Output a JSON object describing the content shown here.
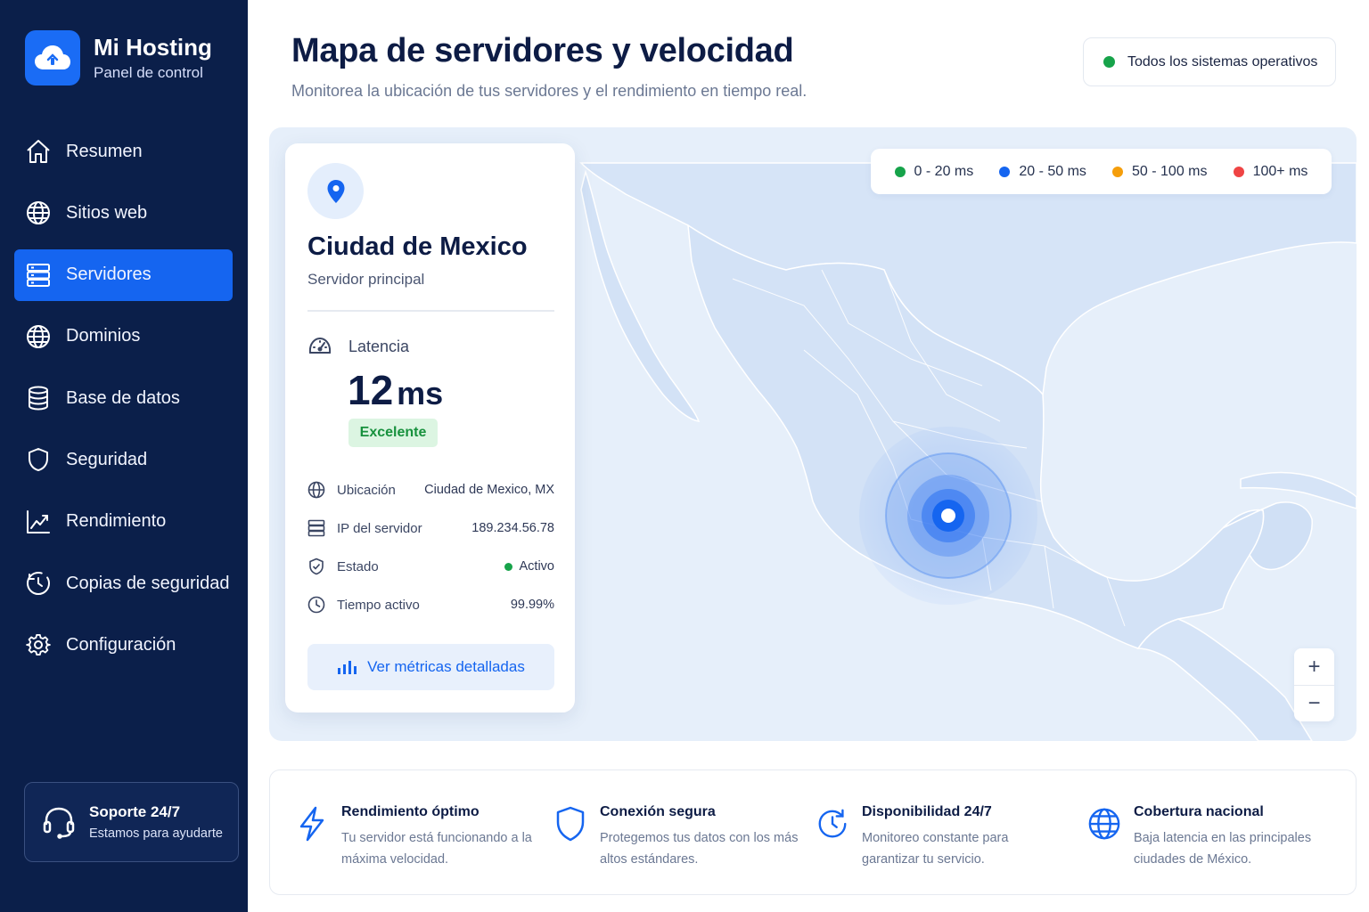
{
  "brand": {
    "title": "Mi Hosting",
    "subtitle": "Panel de control"
  },
  "nav": [
    {
      "label": "Resumen",
      "icon": "home-icon"
    },
    {
      "label": "Sitios web",
      "icon": "globe-icon"
    },
    {
      "label": "Servidores",
      "icon": "server-icon",
      "active": true
    },
    {
      "label": "Dominios",
      "icon": "globe-icon"
    },
    {
      "label": "Base de datos",
      "icon": "database-icon"
    },
    {
      "label": "Seguridad",
      "icon": "shield-icon"
    },
    {
      "label": "Rendimiento",
      "icon": "chart-line-icon"
    },
    {
      "label": "Copias de seguridad",
      "icon": "backup-icon"
    },
    {
      "label": "Configuración",
      "icon": "gear-icon"
    }
  ],
  "support": {
    "title": "Soporte 24/7",
    "subtitle": "Estamos para ayudarte"
  },
  "header": {
    "title": "Mapa de servidores y velocidad",
    "subtitle": "Monitorea la ubicación de tus servidores y el rendimiento en tiempo real.",
    "status": "Todos los sistemas operativos"
  },
  "legend": [
    {
      "label": "0 - 20 ms",
      "color": "#16a34a"
    },
    {
      "label": "20 - 50 ms",
      "color": "#1565f0"
    },
    {
      "label": "50 - 100 ms",
      "color": "#f59e0b"
    },
    {
      "label": "100+ ms",
      "color": "#ef4444"
    }
  ],
  "zoom": {
    "in": "+",
    "out": "−"
  },
  "server": {
    "city": "Ciudad de Mexico",
    "role": "Servidor principal",
    "latency_label": "Latencia",
    "latency_value": "12",
    "latency_unit": "ms",
    "rating": "Excelente",
    "details": [
      {
        "label": "Ubicación",
        "value": "Ciudad de Mexico, MX",
        "icon": "globe-icon"
      },
      {
        "label": "IP del servidor",
        "value": "189.234.56.78",
        "icon": "server-icon"
      },
      {
        "label": "Estado",
        "value": "Activo",
        "icon": "shield-check-icon"
      },
      {
        "label": "Tiempo activo",
        "value": "99.99%",
        "icon": "clock-icon"
      }
    ],
    "metrics_button": "Ver métricas detalladas"
  },
  "features": [
    {
      "title": "Rendimiento óptimo",
      "desc": "Tu servidor está funcionando a la máxima velocidad.",
      "icon": "lightning-icon"
    },
    {
      "title": "Conexión segura",
      "desc": "Protegemos tus datos con los más altos estándares.",
      "icon": "shield-icon"
    },
    {
      "title": "Disponibilidad 24/7",
      "desc": "Monitoreo constante para garantizar tu servicio.",
      "icon": "clock-refresh-icon"
    },
    {
      "title": "Cobertura nacional",
      "desc": "Baja latencia en las principales ciudades de México.",
      "icon": "globe-icon"
    }
  ],
  "colors": {
    "sidebar": "#0b1f4a",
    "accent": "#1565f0",
    "success": "#16a34a"
  }
}
